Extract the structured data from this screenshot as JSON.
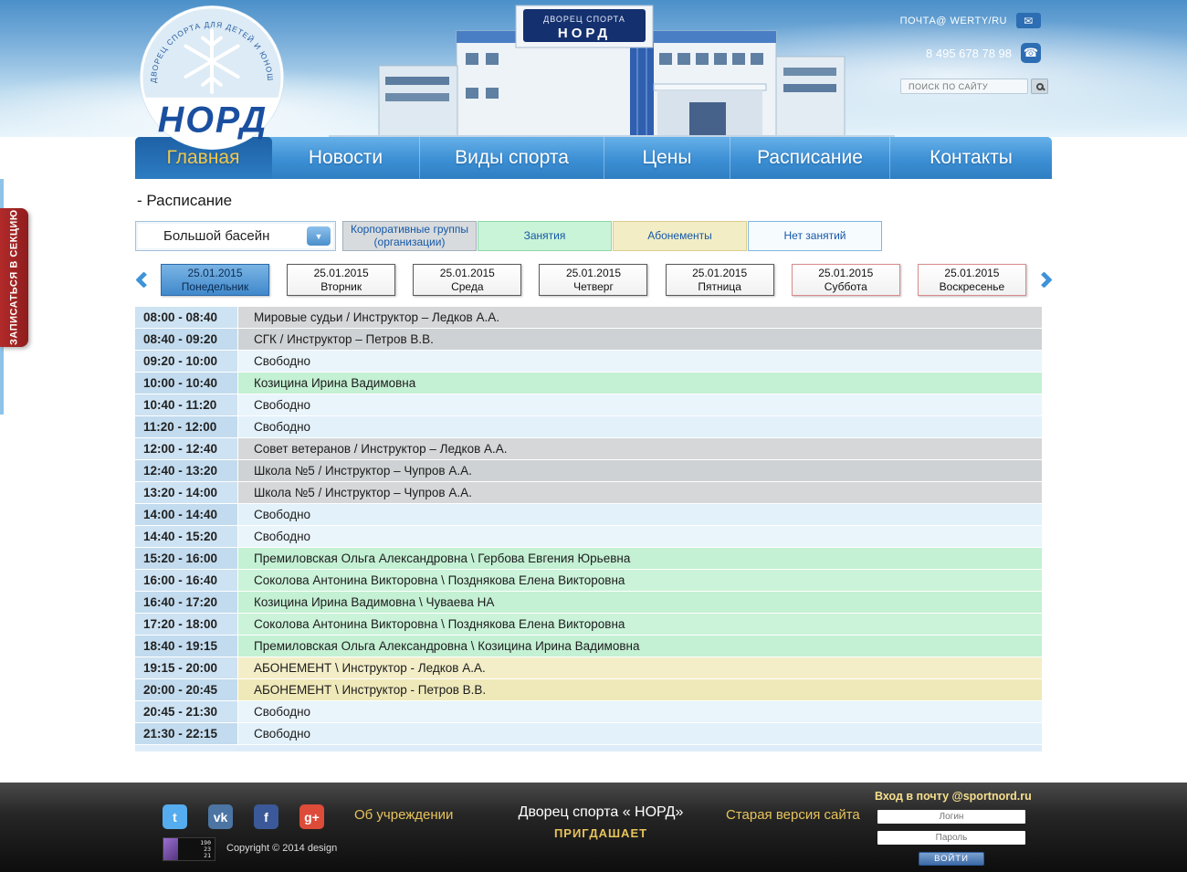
{
  "header": {
    "logo": {
      "arc_text": "ДВОРЕЦ СПОРТА ДЛЯ ДЕТЕЙ И ЮНОШЕСТВА",
      "title": "НОРД"
    },
    "building": {
      "sign_line1": "ДВОРЕЦ СПОРТА",
      "sign_line2": "НОРД"
    },
    "email": "ПОЧТА@ WERTY/RU",
    "phone": "8 495 678 78 98",
    "search_placeholder": "ПОИСК ПО САЙТУ"
  },
  "nav": {
    "items": [
      {
        "label": "Главная",
        "active": true
      },
      {
        "label": "Новости",
        "active": false
      },
      {
        "label": "Виды спорта",
        "active": false
      },
      {
        "label": "Цены",
        "active": false
      },
      {
        "label": "Расписание",
        "active": false
      },
      {
        "label": "Контакты",
        "active": false
      }
    ]
  },
  "side_tab_label": "ЗАПИСАТЬСЯ В СЕКЦИЮ",
  "schedule": {
    "title": "- Расписание",
    "pool_selector": {
      "value": "Большой басейн"
    },
    "legend": [
      {
        "label": "Корпоративные группы (организации)",
        "type": "corporate"
      },
      {
        "label": "Занятия",
        "type": "lesson"
      },
      {
        "label": "Абонементы",
        "type": "abonement"
      },
      {
        "label": "Нет занятий",
        "type": "free"
      }
    ],
    "days": [
      {
        "date": "25.01.2015",
        "day": "Понедельник",
        "active": true,
        "weekend": false
      },
      {
        "date": "25.01.2015",
        "day": "Вторник",
        "active": false,
        "weekend": false
      },
      {
        "date": "25.01.2015",
        "day": "Среда",
        "active": false,
        "weekend": false
      },
      {
        "date": "25.01.2015",
        "day": "Четверг",
        "active": false,
        "weekend": false
      },
      {
        "date": "25.01.2015",
        "day": "Пятница",
        "active": false,
        "weekend": false
      },
      {
        "date": "25.01.2015",
        "day": "Суббота",
        "active": false,
        "weekend": true
      },
      {
        "date": "25.01.2015",
        "day": "Воскресенье",
        "active": false,
        "weekend": true
      }
    ],
    "rows": [
      {
        "time": "08:00 - 08:40",
        "text": "Мировые судьи / Инструктор – Ледков А.А.",
        "type": "corporate"
      },
      {
        "time": "08:40 - 09:20",
        "text": "СГК / Инструктор – Петров В.В.",
        "type": "corporate"
      },
      {
        "time": "09:20 - 10:00",
        "text": "Свободно",
        "type": "free"
      },
      {
        "time": "10:00 - 10:40",
        "text": "Козицина Ирина Вадимовна",
        "type": "lesson"
      },
      {
        "time": "10:40 - 11:20",
        "text": "Свободно",
        "type": "free"
      },
      {
        "time": "11:20 - 12:00",
        "text": "Свободно",
        "type": "free"
      },
      {
        "time": "12:00 - 12:40",
        "text": "Совет ветеранов / Инструктор – Ледков А.А.",
        "type": "corporate"
      },
      {
        "time": "12:40 - 13:20",
        "text": "Школа №5 / Инструктор – Чупров А.А.",
        "type": "corporate"
      },
      {
        "time": "13:20 - 14:00",
        "text": "Школа №5 / Инструктор – Чупров А.А.",
        "type": "corporate"
      },
      {
        "time": "14:00 - 14:40",
        "text": "Свободно",
        "type": "free"
      },
      {
        "time": "14:40 - 15:20",
        "text": "Свободно",
        "type": "free"
      },
      {
        "time": "15:20 - 16:00",
        "text": "Премиловская Ольга Александровна \\ Гербова Евгения Юрьевна",
        "type": "lesson"
      },
      {
        "time": "16:00 - 16:40",
        "text": "Соколова Антонина Викторовна \\ Позднякова Елена Викторовна",
        "type": "lesson"
      },
      {
        "time": "16:40 - 17:20",
        "text": "Козицина Ирина Вадимовна \\ Чуваева НА",
        "type": "lesson"
      },
      {
        "time": "17:20 - 18:00",
        "text": "Соколова Антонина Викторовна \\ Позднякова Елена Викторовна",
        "type": "lesson"
      },
      {
        "time": "18:40 - 19:15",
        "text": "Премиловская Ольга Александровна \\ Козицина Ирина Вадимовна",
        "type": "lesson"
      },
      {
        "time": "19:15 - 20:00",
        "text": "АБОНЕМЕНТ \\ Инструктор - Ледков А.А.",
        "type": "abonement"
      },
      {
        "time": "20:00 - 20:45",
        "text": "АБОНЕМЕНТ \\ Инструктор - Петров В.В.",
        "type": "abonement"
      },
      {
        "time": "20:45 - 21:30",
        "text": "Свободно",
        "type": "free"
      },
      {
        "time": "21:30 - 22:15",
        "text": "Свободно",
        "type": "free"
      }
    ]
  },
  "footer": {
    "social": [
      {
        "name": "twitter",
        "glyph": "t",
        "color": "#55acee"
      },
      {
        "name": "vk",
        "glyph": "vk",
        "color": "#4c75a3"
      },
      {
        "name": "facebook",
        "glyph": "f",
        "color": "#3b5998"
      },
      {
        "name": "google-plus",
        "glyph": "g+",
        "color": "#dd4b39"
      }
    ],
    "about": "Об учреждении",
    "palace_title": "Дворец спорта « НОРД»",
    "invites": "ПРИГДАШАЕТ",
    "old_version": "Старая версия сайта",
    "mail": {
      "title": "Вход в почту @sportnord.ru",
      "login_placeholder": "Логин",
      "password_placeholder": "Пароль",
      "button": "ВОЙТИ"
    },
    "counter": [
      "190",
      "23",
      "21"
    ],
    "copyright": "Copyright © 2014 design"
  },
  "colors": {
    "nav_blue": "#3c8fd4",
    "active_gold": "#f2c94c",
    "corporate": "#d5d7d9",
    "lesson_green": "#cbf3d9",
    "abonement_yellow": "#f3eec8",
    "free_blue": "#e9f4fb",
    "weekend_border": "#d98c8c",
    "signup_red": "#9e1f1f"
  }
}
